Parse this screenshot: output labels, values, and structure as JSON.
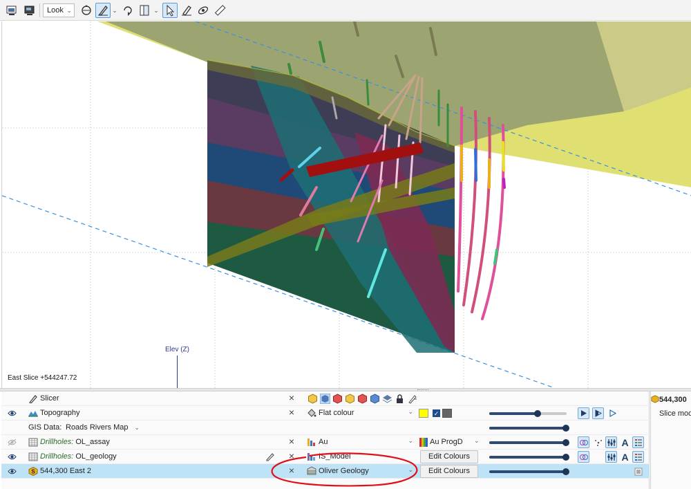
{
  "toolbar": {
    "view_mode": "Look",
    "icons": [
      "window-icon",
      "window-dark-icon",
      "rotate-icon",
      "slicer-pen-icon",
      "rotate-axis-icon",
      "panel-icon",
      "select-pointer-icon",
      "eraser-pen-icon",
      "orbit-icon",
      "ruler-icon"
    ]
  },
  "viewport": {
    "slice_label": "East Slice +544247.72",
    "axis_label": "Elev (Z)"
  },
  "scene_list": {
    "rows": [
      {
        "name": "Slicer",
        "visible": null
      },
      {
        "name": "Topography",
        "visible": true,
        "colouring": "Flat colour",
        "colour": "#ffff00"
      },
      {
        "gis_label": "GIS Data:",
        "gis_value": "Roads Rivers Map"
      },
      {
        "prefix": "Drillholes:",
        "name": "OL_assay",
        "visible": false,
        "colouring": "Au",
        "legend": "Au ProgD"
      },
      {
        "prefix": "Drillholes:",
        "name": "OL_geology",
        "visible": true,
        "colouring": "IS_Model",
        "button": "Edit Colours"
      },
      {
        "name": "544,300 East 2",
        "visible": true,
        "colouring": "Oliver Geology",
        "button": "Edit Colours",
        "selected": true
      }
    ]
  },
  "properties": {
    "title": "544,300",
    "subtitle": "Slice mode"
  },
  "colors": {
    "selection": "#bfe3f6",
    "annotation": "#e0101a",
    "slider_fill": "#2f4a72"
  }
}
